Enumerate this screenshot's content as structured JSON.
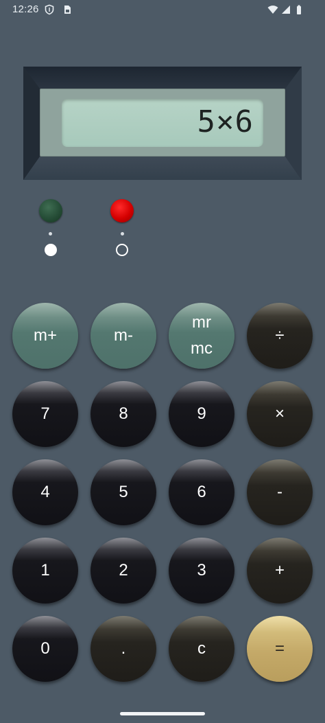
{
  "status_bar": {
    "time": "12:26",
    "icons": [
      "shield-icon",
      "sim-card-icon",
      "wifi-icon",
      "signal-icon",
      "battery-icon"
    ]
  },
  "display": {
    "value": "5×6"
  },
  "indicators": {
    "green_led": "green-led",
    "red_led": "red-led",
    "switch_left_state": "on",
    "switch_right_state": "off"
  },
  "keys": {
    "m_plus": "m+",
    "m_minus": "m-",
    "mr_line1": "mr",
    "mr_line2": "mc",
    "divide": "÷",
    "seven": "7",
    "eight": "8",
    "nine": "9",
    "multiply": "×",
    "four": "4",
    "five": "5",
    "six": "6",
    "minus": "-",
    "one": "1",
    "two": "2",
    "three": "3",
    "plus": "+",
    "zero": "0",
    "dot": ".",
    "clear": "c",
    "equals": "="
  },
  "colors": {
    "background": "#4d5a66",
    "lcd": "#a7c9bb",
    "memory_key": "#547870",
    "equals_key": "#c4a968",
    "led_green": "#234a34",
    "led_red": "#d40000"
  }
}
